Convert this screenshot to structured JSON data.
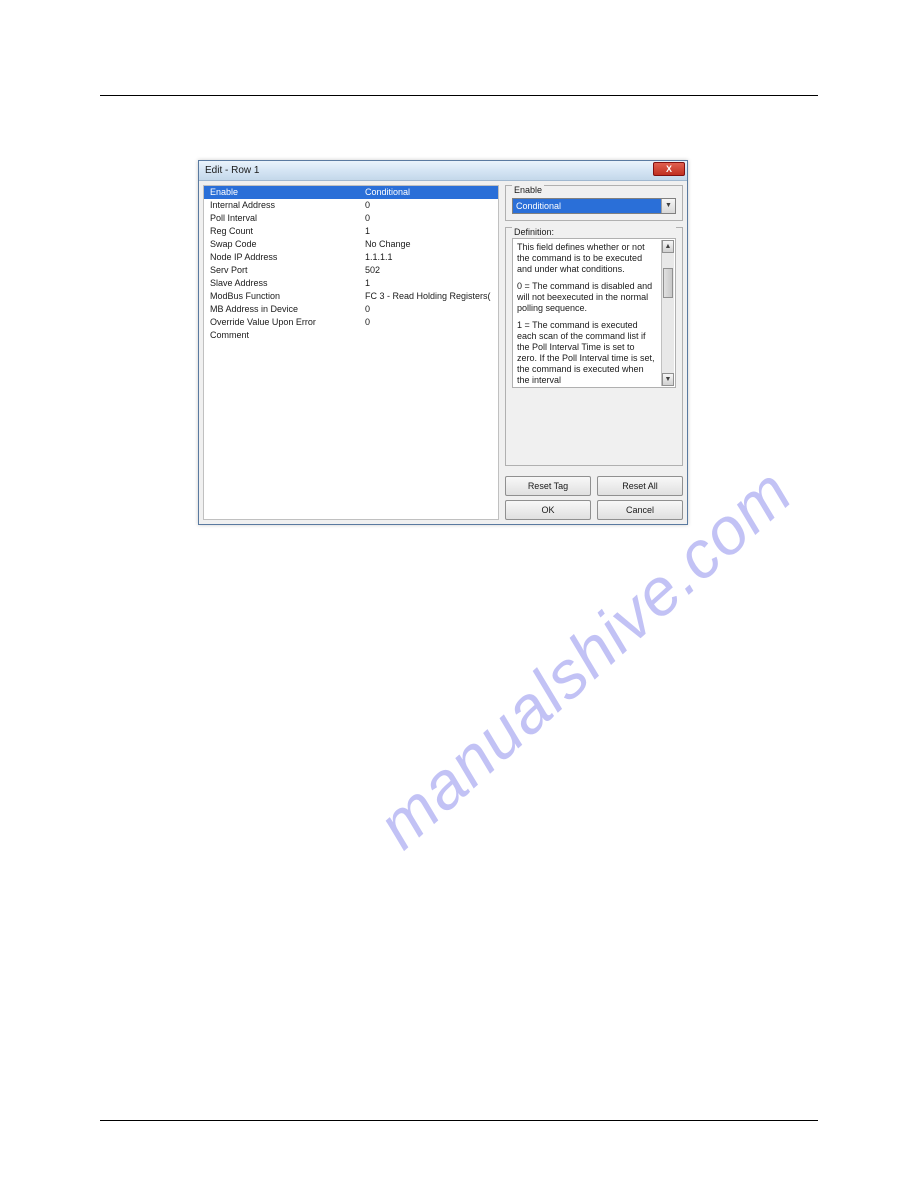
{
  "dialog": {
    "title": "Edit - Row 1",
    "close_glyph": "X"
  },
  "properties": [
    {
      "name": "Enable",
      "value": "Conditional",
      "selected": true
    },
    {
      "name": "Internal Address",
      "value": "0"
    },
    {
      "name": "Poll Interval",
      "value": "0"
    },
    {
      "name": "Reg Count",
      "value": "1"
    },
    {
      "name": "Swap Code",
      "value": "No Change"
    },
    {
      "name": "Node IP Address",
      "value": "1.1.1.1"
    },
    {
      "name": "Serv Port",
      "value": "502"
    },
    {
      "name": "Slave Address",
      "value": "1"
    },
    {
      "name": "ModBus Function",
      "value": "FC 3 - Read Holding Registers("
    },
    {
      "name": "MB Address in Device",
      "value": "0"
    },
    {
      "name": "Override Value Upon Error",
      "value": "0"
    },
    {
      "name": "Comment",
      "value": ""
    }
  ],
  "right": {
    "field_label": "Enable",
    "combo_value": "Conditional",
    "def_label": "Definition:",
    "def_p1": "This field defines whether or not the command is to be executed and under what conditions.",
    "def_p2": "0 = The command is disabled and will not beexecuted in the normal polling sequence.",
    "def_p3": "1 = The command is executed each scan of the command list if the Poll Interval Time is set to zero. If the Poll Interval time is set, the command is executed when the interval"
  },
  "buttons": {
    "reset_tag": "Reset Tag",
    "reset_all": "Reset All",
    "ok": "OK",
    "cancel": "Cancel"
  },
  "watermark": "manualshive.com"
}
